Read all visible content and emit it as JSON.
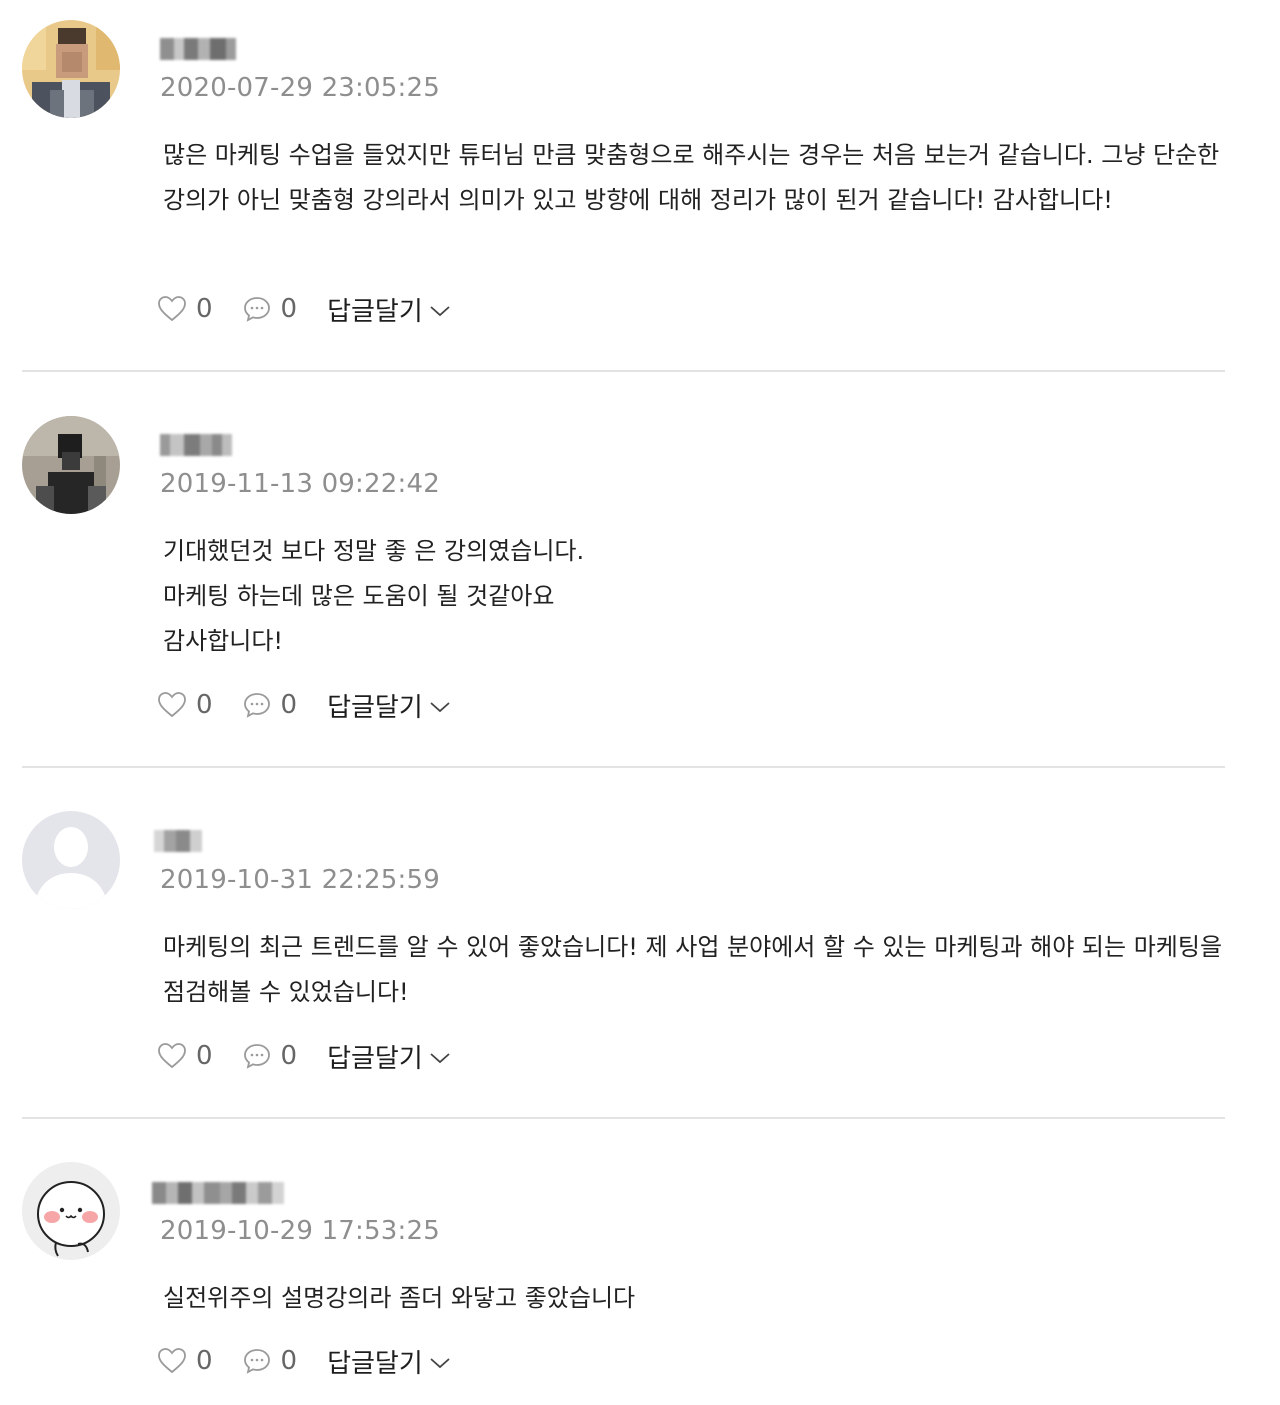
{
  "comments": [
    {
      "author": "",
      "timestamp": "2020-07-29 23:05:25",
      "text": "많은 마케팅 수업을 들었지만 튜터님 만큼 맞춤형으로 해주시는 경우는 처음 보는거 같습니다. 그냥 단순한 강의가 아닌 맞춤형 강의라서 의미가 있고 방향에 대해 정리가 많이 된거 같습니다! 감사합니다!",
      "likes": "0",
      "replies": "0",
      "reply_label": "답글달기",
      "avatar_icon": "user-photo-avatar"
    },
    {
      "author": "",
      "timestamp": "2019-11-13 09:22:42",
      "text": "기대했던것 보다 정말 좋 은 강의였습니다.\n마케팅 하는데 많은 도움이 될 것같아요\n감사합니다!",
      "likes": "0",
      "replies": "0",
      "reply_label": "답글달기",
      "avatar_icon": "user-photo-avatar"
    },
    {
      "author": "",
      "timestamp": "2019-10-31 22:25:59",
      "text": "마케팅의 최근 트렌드를 알 수 있어 좋았습니다! 제 사업 분야에서 할 수 있는 마케팅과 해야 되는 마케팅을 점검해볼 수 있었습니다!",
      "likes": "0",
      "replies": "0",
      "reply_label": "답글달기",
      "avatar_icon": "default-user-avatar"
    },
    {
      "author": "",
      "timestamp": "2019-10-29 17:53:25",
      "text": "실전위주의 설명강의라 좀더 와닿고 좋았습니다",
      "likes": "0",
      "replies": "0",
      "reply_label": "답글달기",
      "avatar_icon": "cartoon-character-avatar"
    }
  ],
  "colors": {
    "timestamp": "#8e8e8e",
    "divider": "#e3e3e3",
    "icon": "#9a9a9a"
  }
}
